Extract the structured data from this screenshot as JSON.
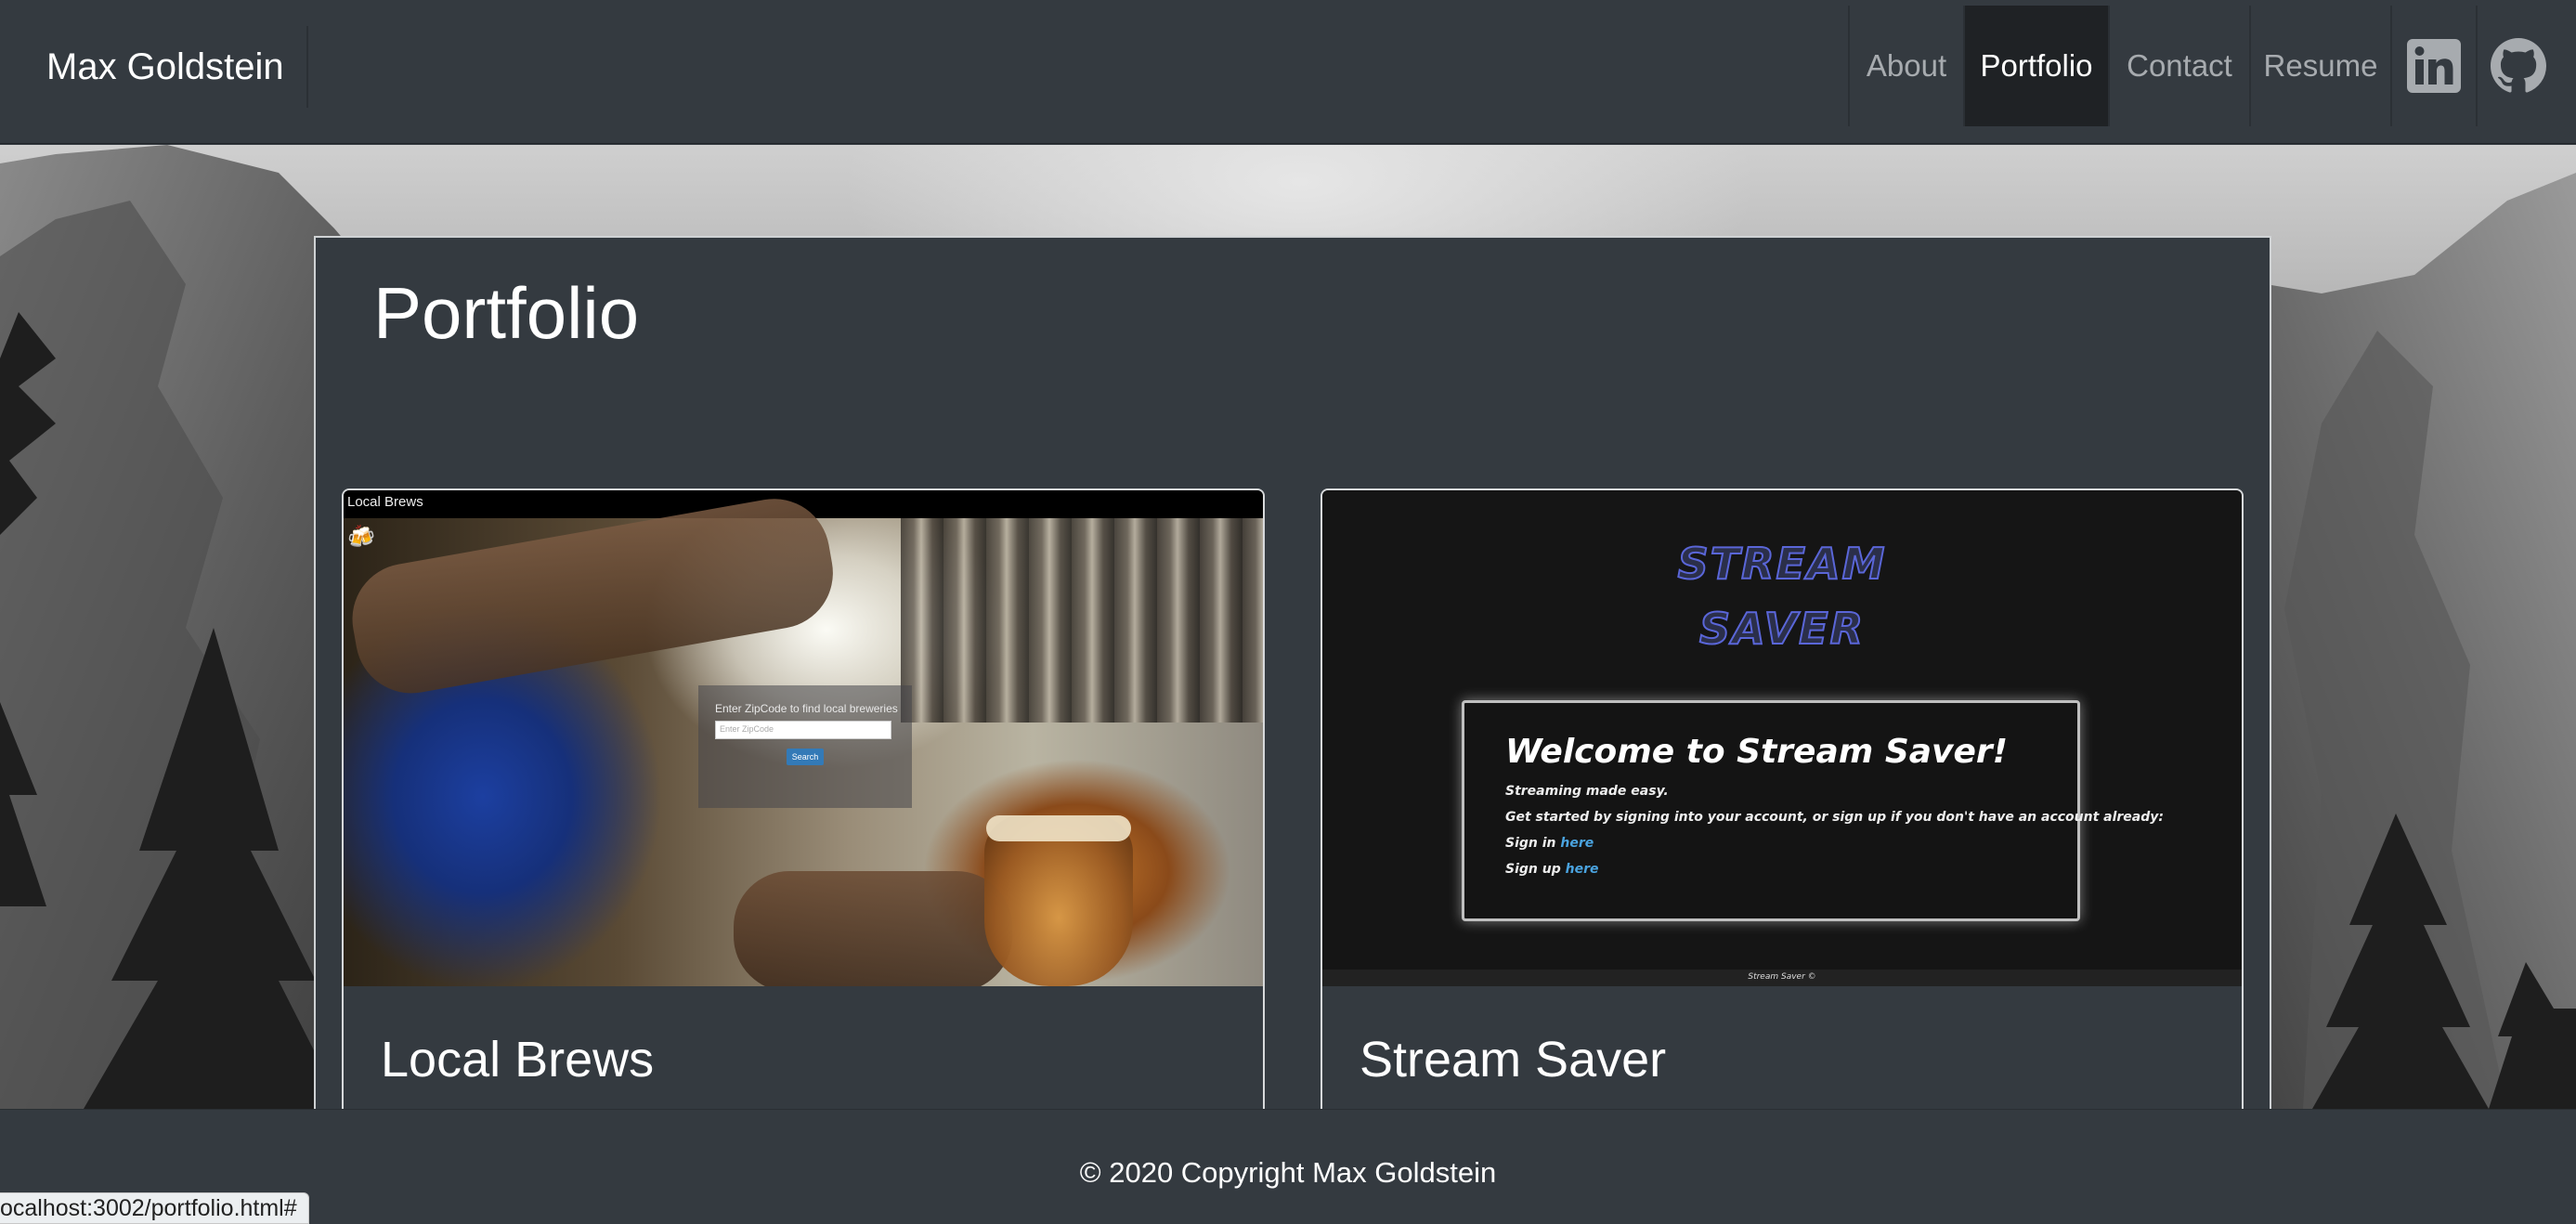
{
  "navbar": {
    "brand": "Max Goldstein",
    "items": [
      {
        "label": "About",
        "active": false
      },
      {
        "label": "Portfolio",
        "active": true
      },
      {
        "label": "Contact",
        "active": false
      },
      {
        "label": "Resume",
        "active": false
      }
    ],
    "icons": [
      "linkedin-icon",
      "github-icon"
    ]
  },
  "main": {
    "title": "Portfolio",
    "cards": [
      {
        "title": "Local Brews",
        "screenshot": {
          "header": "Local Brews",
          "form_label": "Enter ZipCode to find local breweries",
          "input_placeholder": "Enter ZipCode",
          "search_label": "Search"
        }
      },
      {
        "title": "Stream Saver",
        "screenshot": {
          "logo_line1": "STREAM",
          "logo_line2": "SAVER",
          "heading": "Welcome to Stream Saver!",
          "tagline": "Streaming made easy.",
          "intro": "Get started by signing into your account, or sign up if you don't have an account already:",
          "sign_in": "Sign in",
          "sign_up": "Sign up",
          "link_text": "here",
          "footer": "Stream Saver ©"
        }
      }
    ]
  },
  "footer": {
    "text": "© 2020 Copyright Max Goldstein"
  },
  "status_bar": {
    "url": "ocalhost:3002/portfolio.html#"
  },
  "colors": {
    "navbar_bg": "#343a40",
    "active_nav_bg": "#1f2225",
    "link": "#4aa3df"
  }
}
